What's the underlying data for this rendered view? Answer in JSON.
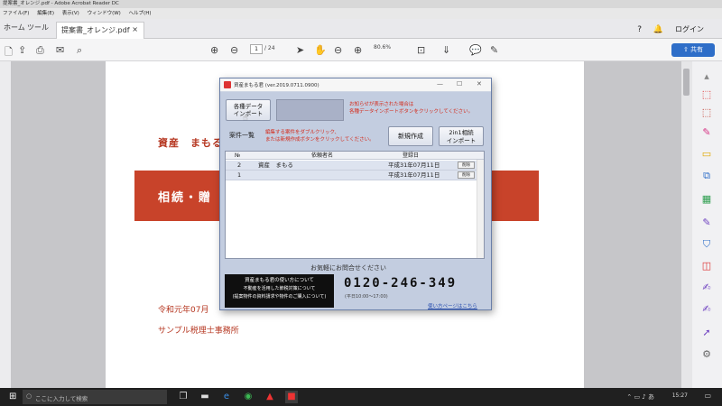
{
  "window": {
    "title": "提案書_オレンジ.pdf - Adobe Acrobat Reader DC"
  },
  "menu": [
    "ファイル(F)",
    "編集(E)",
    "表示(V)",
    "ウィンドウ(W)",
    "ヘルプ(H)"
  ],
  "tabs": {
    "home": "ホーム",
    "tools": "ツール",
    "document": "提案書_オレンジ.pdf",
    "close": "×"
  },
  "header_right": {
    "help": "?",
    "bell": "🔔",
    "login": "ログイン"
  },
  "toolbar": {
    "page_current": "1",
    "page_total": "/ 24",
    "zoom": "80.6%",
    "share": "共有"
  },
  "pdf": {
    "title": "資産　まもる",
    "band_text": "相続・贈",
    "date": "令和元年07月",
    "office": "サンプル税理士事務所"
  },
  "dialog": {
    "title": "資産まもる君 (ver.2019.0711.0900)",
    "import_btn_line1": "各種データ",
    "import_btn_line2": "インポート",
    "import_note_line1": "お知らせが表示された場合は",
    "import_note_line2": "各種データインポートボタンをクリックしてください。",
    "case_list_label": "案件一覧",
    "case_note_line1": "編集する案件をダブルクリック、",
    "case_note_line2": "または新規作成ボタンをクリックしてください。",
    "new_btn": "新規作成",
    "import2_line1": "2in1相続",
    "import2_line2": "インポート",
    "columns": {
      "no": "№",
      "name": "依頼者名",
      "date": "登録日"
    },
    "rows": [
      {
        "no": "2",
        "name": "資産　まもる",
        "date": "平成31年07月11日",
        "action": "削除"
      },
      {
        "no": "1",
        "name": "",
        "date": "平成31年07月11日",
        "action": "削除"
      }
    ],
    "contact_heading": "お気軽にお問合せください",
    "black_box_line1": "資産まもる君の使い方について",
    "black_box_line2": "不動産を活用した節税対策について",
    "black_box_line3": "(提案物件の資料請求や物件のご購入について)",
    "phone": "0120-246-349",
    "hours": "(平日10:00〜17:00)",
    "help_link": "使い方ページはこちら"
  },
  "taskbar": {
    "search_placeholder": "ここに入力して検索",
    "clock": "15:27"
  }
}
